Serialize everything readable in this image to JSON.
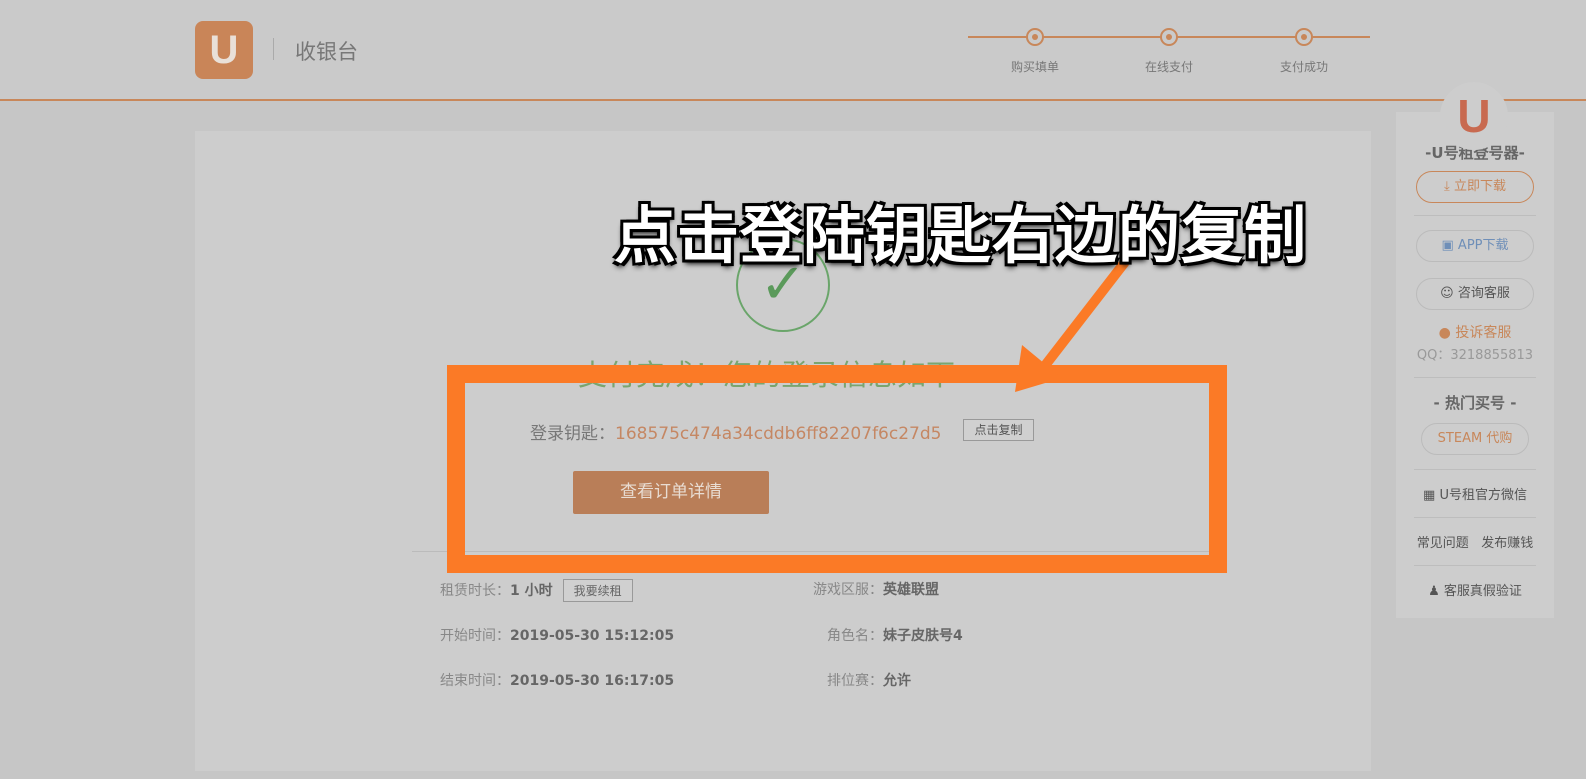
{
  "header": {
    "logo": "U",
    "title": "收银台",
    "steps": [
      "购买填单",
      "在线支付",
      "支付成功"
    ]
  },
  "main": {
    "success_text": "支付完成！您的登录信息如下",
    "key_label": "登录钥匙：",
    "key_value": "168575c474a34cddb6ff82207f6c27d5",
    "copy_button": "点击复制",
    "order_button": "查看订单详情",
    "info": {
      "duration_label": "租赁时长：",
      "duration_value": "1 小时",
      "renew_button": "我要续租",
      "start_label": "开始时间：",
      "start_value": "2019-05-30 15:12:05",
      "end_label": "结束时间：",
      "end_value": "2019-05-30 16:17:05",
      "server_label": "游戏区服：",
      "server_value": "英雄联盟",
      "role_label": "角色名：",
      "role_value": "妹子皮肤号4",
      "rank_label": "排位赛：",
      "rank_value": "允许"
    }
  },
  "annotation": {
    "caption": "点击登陆钥匙右边的复制",
    "color": "#fb7a26"
  },
  "sidebar": {
    "logo": "U",
    "title": "-U号租登号器-",
    "download": "立即下载",
    "app": "APP下载",
    "consult": "咨询客服",
    "complain": "投诉客服",
    "qq": "QQ：3218855813",
    "hot": "- 热门买号 -",
    "steam": "STEAM 代购",
    "wechat": "U号租官方微信",
    "faq": "常见问题",
    "publish": "发布赚钱",
    "verify": "客服真假验证"
  }
}
